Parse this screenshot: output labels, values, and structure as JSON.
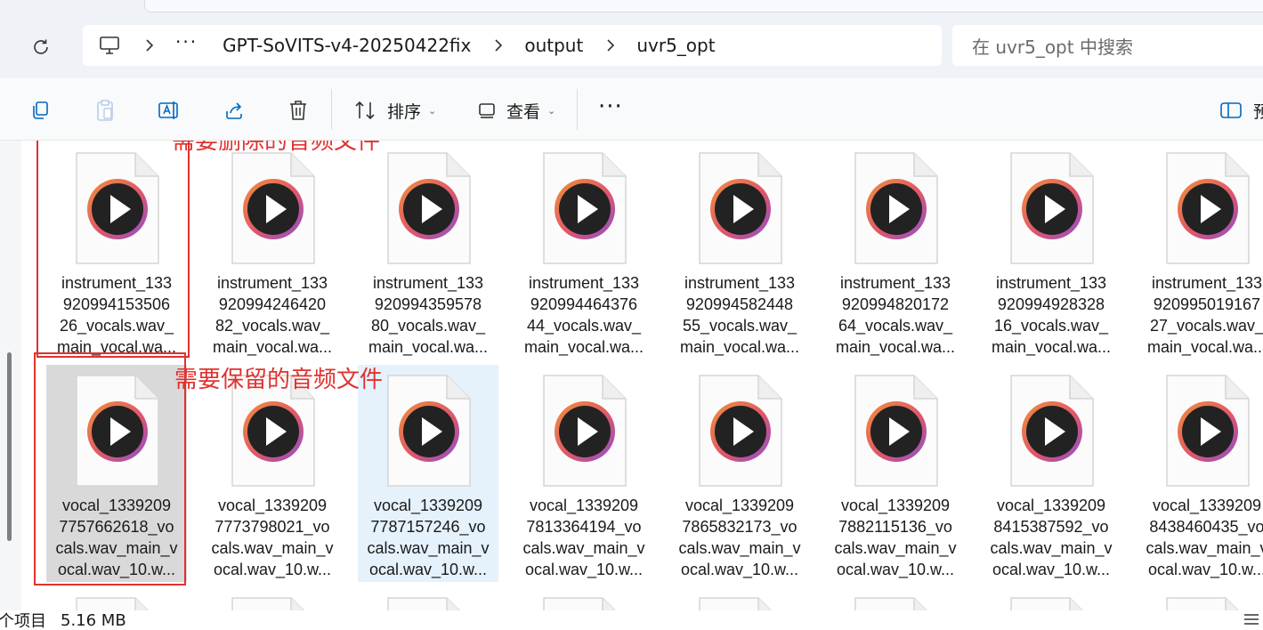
{
  "address": {
    "crumbs": [
      "GPT-SoVITS-v4-20250422fix",
      "output",
      "uvr5_opt"
    ],
    "overflow": "···"
  },
  "search": {
    "placeholder": "在 uvr5_opt 中搜索"
  },
  "toolbar": {
    "sort_label": "排序",
    "view_label": "查看",
    "more_label": "···",
    "preview_label": "预"
  },
  "files": [
    {
      "name": "instrument_133\n920994153506\n26_vocals.wav_\nmain_vocal.wa..."
    },
    {
      "name": "instrument_133\n920994246420\n82_vocals.wav_\nmain_vocal.wa..."
    },
    {
      "name": "instrument_133\n920994359578\n80_vocals.wav_\nmain_vocal.wa..."
    },
    {
      "name": "instrument_133\n920994464376\n44_vocals.wav_\nmain_vocal.wa..."
    },
    {
      "name": "instrument_133\n920994582448\n55_vocals.wav_\nmain_vocal.wa..."
    },
    {
      "name": "instrument_133\n920994820172\n64_vocals.wav_\nmain_vocal.wa..."
    },
    {
      "name": "instrument_133\n920994928328\n16_vocals.wav_\nmain_vocal.wa..."
    },
    {
      "name": "instrument_133\n920995019167\n27_vocals.wav_\nmain_vocal.wa..."
    },
    {
      "name": "vocal_1339209\n7757662618_vo\ncals.wav_main_v\nocal.wav_10.w..."
    },
    {
      "name": "vocal_1339209\n7773798021_vo\ncals.wav_main_v\nocal.wav_10.w..."
    },
    {
      "name": "vocal_1339209\n7787157246_vo\ncals.wav_main_v\nocal.wav_10.w..."
    },
    {
      "name": "vocal_1339209\n7813364194_vo\ncals.wav_main_v\nocal.wav_10.w..."
    },
    {
      "name": "vocal_1339209\n7865832173_vo\ncals.wav_main_v\nocal.wav_10.w..."
    },
    {
      "name": "vocal_1339209\n7882115136_vo\ncals.wav_main_v\nocal.wav_10.w..."
    },
    {
      "name": "vocal_1339209\n8415387592_vo\ncals.wav_main_v\nocal.wav_10.w..."
    },
    {
      "name": "vocal_1339209\n8438460435_vo\ncals.wav_main_v\nocal.wav_10.w..."
    }
  ],
  "annotations": {
    "delete_note": "需要删除的音频文件",
    "keep_note": "需要保留的音频文件"
  },
  "status": {
    "item_count": "个项目",
    "size": "5.16 MB"
  },
  "colors": {
    "annotation": "#e0322f",
    "selected_bg": "#d9d9d9",
    "hover_bg": "#e5f1fb",
    "accent": "#0067c0"
  }
}
